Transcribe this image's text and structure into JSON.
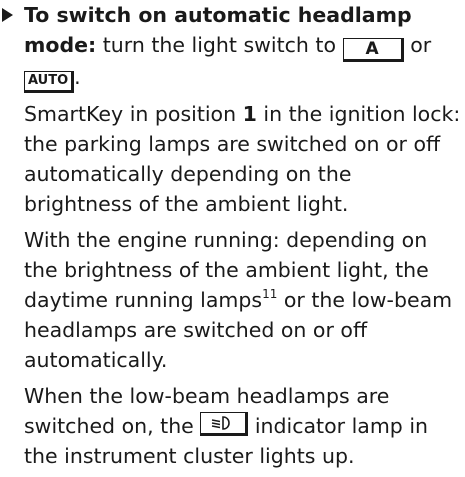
{
  "step": {
    "heading": "To switch on automatic headlamp mode:",
    "intro": " turn the light switch to ",
    "key_a": "A",
    "or": " or",
    "key_auto": "AUTO",
    "period": ".",
    "p1_pre": "SmartKey in position ",
    "p1_num": "1",
    "p1_post": " in the ignition lock: the parking lamps are switched on or off automatically depending on the brightness of the ambient light.",
    "p2_pre": "With the engine running: depending on the brightness of the ambient light, the daytime running lamps",
    "p2_footnote": "11",
    "p2_post": " or the low-beam headlamps are switched on or off automatically.",
    "p3_pre": "When the low-beam headlamps are switched on, the ",
    "p3_icon": "low-beam-headlamp-icon",
    "p3_post": " indicator lamp in the instrument cluster lights up."
  },
  "colors": {
    "text": "#1a1a1a",
    "background": "#ffffff"
  }
}
